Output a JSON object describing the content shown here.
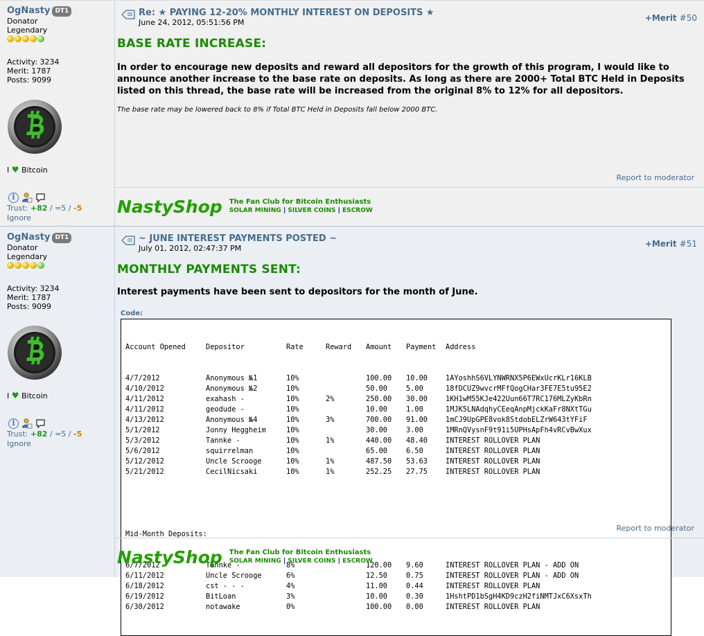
{
  "posts": [
    {
      "author": {
        "name": "OgNasty",
        "badge": "DT1",
        "rank1": "Donator",
        "rank2": "Legendary",
        "activity": "Activity: 3234",
        "merit": "Merit: 1787",
        "posts": "Posts: 9099",
        "ilove": "Bitcoin",
        "ilove_prefix": "I",
        "trust_label": "Trust:",
        "trust_pos": "+82",
        "trust_mid": " / =5 / ",
        "trust_neg": "-5",
        "ignore": "Ignore"
      },
      "subject": "Re: ★ PAYING 12-20% MONTHLY INTEREST ON DEPOSITS ★",
      "date": "June 24, 2012, 05:51:56 PM",
      "merit_label": "+Merit",
      "post_number": "#50",
      "heading": "BASE RATE INCREASE:",
      "paragraph": "In order to encourage new deposits and reward all depositors for the growth of this program, I would like to announce another increase to the base rate on deposits.  As long as there are 2000+ Total BTC Held in Deposits listed on this thread, the base rate will be increased from the original 8% to 12% for all depositors.",
      "note": "The base rate may be lowered back to 8% if Total BTC Held in Deposits fall below 2000 BTC.",
      "report": "Report to moderator",
      "signature": {
        "shop": "NastyShop",
        "tagline": "The Fan Club for Bitcoin Enthusiasts",
        "links": [
          "SOLAR MINING",
          "SILVER COINS",
          "ESCROW"
        ]
      }
    },
    {
      "author": {
        "name": "OgNasty",
        "badge": "DT1",
        "rank1": "Donator",
        "rank2": "Legendary",
        "activity": "Activity: 3234",
        "merit": "Merit: 1787",
        "posts": "Posts: 9099",
        "ilove": "Bitcoin",
        "ilove_prefix": "I",
        "trust_label": "Trust:",
        "trust_pos": "+82",
        "trust_mid": " / =5 / ",
        "trust_neg": "-5",
        "ignore": "Ignore"
      },
      "subject": "~ JUNE INTEREST PAYMENTS POSTED ~",
      "date": "July 01, 2012, 02:47:37 PM",
      "merit_label": "+Merit",
      "post_number": "#51",
      "heading": "MONTHLY PAYMENTS SENT:",
      "paragraph": "Interest payments have been sent to depositors for the month of June.",
      "code_label": "Code:",
      "table": {
        "headers": [
          "Account Opened",
          "Depositor",
          "Rate",
          "Reward",
          "Amount",
          "Payment",
          "Address"
        ],
        "rows": [
          [
            "4/7/2012",
            "Anonymous №1",
            "10%",
            "",
            "100.00",
            "10.00",
            "1AYoshhS6VLYNWRNX5P6EWxUcrKLr16KLB"
          ],
          [
            "4/10/2012",
            "Anonymous №2",
            "10%",
            "",
            "50.00",
            "5.00",
            "18fDCUZ9wvcrMFfQogCHar3FE7E5tu95E2"
          ],
          [
            "4/11/2012",
            "exahash -",
            "10%",
            "2%",
            "250.00",
            "30.00",
            "1KH1wM55KJe422Uun66T7RC176MLZyKbRn"
          ],
          [
            "4/11/2012",
            "geodude -",
            "10%",
            "",
            "10.00",
            "1.00",
            "1MJK5LNAdqhyCEeqAnpMjckKaFr8NXtTGu"
          ],
          [
            "4/13/2012",
            "Anonymous №4",
            "10%",
            "3%",
            "700.00",
            "91.00",
            "1mCJ9UpGPE8vok8StdobELZrW643tYFiF"
          ],
          [
            "5/1/2012",
            "Jonny Heggheim",
            "10%",
            "",
            "30.00",
            "3.00",
            "1MRnQVysnF9t91i5UPHsApFh4vRCvBwXux"
          ],
          [
            "5/3/2012",
            "Tannke -",
            "10%",
            "1%",
            "440.00",
            "48.40",
            "INTEREST ROLLOVER PLAN"
          ],
          [
            "5/6/2012",
            "squirrelman",
            "10%",
            "",
            "65.00",
            "6.50",
            "INTEREST ROLLOVER PLAN"
          ],
          [
            "5/12/2012",
            "Uncle Scrooge",
            "10%",
            "1%",
            "487.50",
            "53.63",
            "INTEREST ROLLOVER PLAN"
          ],
          [
            "5/21/2012",
            "CecilNicsaki",
            "10%",
            "1%",
            "252.25",
            "27.75",
            "INTEREST ROLLOVER PLAN"
          ]
        ],
        "midmonth_label": "Mid-Month Deposits:",
        "midmonth_rows": [
          [
            "6/7/2012",
            "Tannke -",
            "8%",
            "",
            "120.00",
            "9.60",
            "INTEREST ROLLOVER PLAN - ADD ON"
          ],
          [
            "6/11/2012",
            "Uncle Scrooge",
            "6%",
            "",
            "12.50",
            "0.75",
            "INTEREST ROLLOVER PLAN - ADD ON"
          ],
          [
            "6/18/2012",
            "cst - - -",
            "4%",
            "",
            "11.00",
            "0.44",
            "INTEREST ROLLOVER PLAN"
          ],
          [
            "6/19/2012",
            "BitLoan",
            "3%",
            "",
            "10.00",
            "0.30",
            "1HshtPD1bSgH4KD9czH2fiNMTJxC6XsxTh"
          ],
          [
            "6/30/2012",
            "notawake",
            "0%",
            "",
            "100.00",
            "0.00",
            "INTEREST ROLLOVER PLAN"
          ]
        ]
      },
      "report": "Report to moderator",
      "signature": {
        "shop": "NastyShop",
        "tagline": "The Fan Club for Bitcoin Enthusiasts",
        "links": [
          "SOLAR MINING",
          "SILVER COINS",
          "ESCROW"
        ]
      }
    }
  ],
  "colors": {
    "link": "#476c8e",
    "heading_green": "#1a8a00",
    "shop_green": "#22a000",
    "trust_pos": "#1a9b1a",
    "trust_neg": "#d47f00"
  }
}
